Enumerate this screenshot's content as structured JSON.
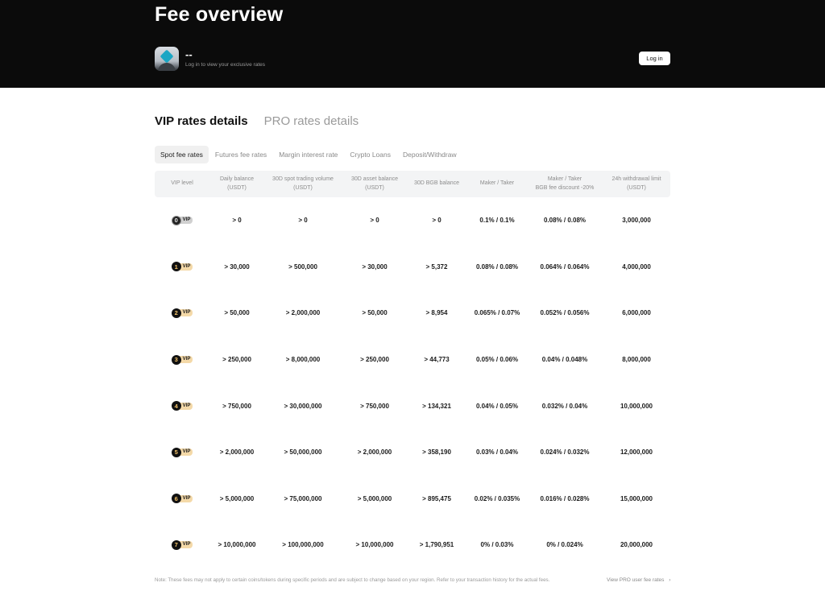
{
  "hero": {
    "title": "Fee overview",
    "user_name": "--",
    "user_subtitle": "Log in to view your exclusive rates",
    "login_label": "Log in"
  },
  "section_tabs": [
    {
      "label": "VIP rates details",
      "active": true
    },
    {
      "label": "PRO rates details",
      "active": false
    }
  ],
  "sub_tabs": [
    {
      "label": "Spot fee rates",
      "active": true
    },
    {
      "label": "Futures fee rates",
      "active": false
    },
    {
      "label": "Margin interest rate",
      "active": false
    },
    {
      "label": "Crypto Loans",
      "active": false
    },
    {
      "label": "Deposit/Withdraw",
      "active": false
    }
  ],
  "table": {
    "headers": [
      "VIP level",
      "Daily balance\n(USDT)",
      "30D spot trading volume\n(USDT)",
      "30D asset balance\n(USDT)",
      "30D BGB balance",
      "Maker / Taker",
      "Maker / Taker\nBGB fee discount -20%",
      "24h withdrawal limit\n(USDT)"
    ],
    "rows": [
      {
        "level": "0",
        "tag": "VIP",
        "daily": "> 0",
        "volume": "> 0",
        "asset": "> 0",
        "bgb": "> 0",
        "maker_taker": "0.1% / 0.1%",
        "discount": "0.08% / 0.08%",
        "limit": "3,000,000"
      },
      {
        "level": "1",
        "tag": "VIP",
        "daily": "> 30,000",
        "volume": "> 500,000",
        "asset": "> 30,000",
        "bgb": "> 5,372",
        "maker_taker": "0.08% / 0.08%",
        "discount": "0.064% / 0.064%",
        "limit": "4,000,000"
      },
      {
        "level": "2",
        "tag": "VIP",
        "daily": "> 50,000",
        "volume": "> 2,000,000",
        "asset": "> 50,000",
        "bgb": "> 8,954",
        "maker_taker": "0.065% / 0.07%",
        "discount": "0.052% / 0.056%",
        "limit": "6,000,000"
      },
      {
        "level": "3",
        "tag": "VIP",
        "daily": "> 250,000",
        "volume": "> 8,000,000",
        "asset": "> 250,000",
        "bgb": "> 44,773",
        "maker_taker": "0.05% / 0.06%",
        "discount": "0.04% / 0.048%",
        "limit": "8,000,000"
      },
      {
        "level": "4",
        "tag": "VIP",
        "daily": "> 750,000",
        "volume": "> 30,000,000",
        "asset": "> 750,000",
        "bgb": "> 134,321",
        "maker_taker": "0.04% / 0.05%",
        "discount": "0.032% / 0.04%",
        "limit": "10,000,000"
      },
      {
        "level": "5",
        "tag": "VIP",
        "daily": "> 2,000,000",
        "volume": "> 50,000,000",
        "asset": "> 2,000,000",
        "bgb": "> 358,190",
        "maker_taker": "0.03% / 0.04%",
        "discount": "0.024% / 0.032%",
        "limit": "12,000,000"
      },
      {
        "level": "6",
        "tag": "VIP",
        "daily": "> 5,000,000",
        "volume": "> 75,000,000",
        "asset": "> 5,000,000",
        "bgb": "> 895,475",
        "maker_taker": "0.02% / 0.035%",
        "discount": "0.016% / 0.028%",
        "limit": "15,000,000"
      },
      {
        "level": "7",
        "tag": "VIP",
        "daily": "> 10,000,000",
        "volume": "> 100,000,000",
        "asset": "> 10,000,000",
        "bgb": "> 1,790,951",
        "maker_taker": "0% / 0.03%",
        "discount": "0% / 0.024%",
        "limit": "20,000,000"
      }
    ]
  },
  "footer": {
    "note": "Note: These fees may not apply to certain coins/tokens during specific periods and are subject to change based on your region. Refer to your transaction history for the actual fees.",
    "link_label": "View PRO user fee rates",
    "link_icon": "chevron-right-icon"
  },
  "colors": {
    "hero_bg": "#0b0b0b",
    "vip_tag": "#f4d9a8",
    "header_bg": "#f3f4f5"
  }
}
